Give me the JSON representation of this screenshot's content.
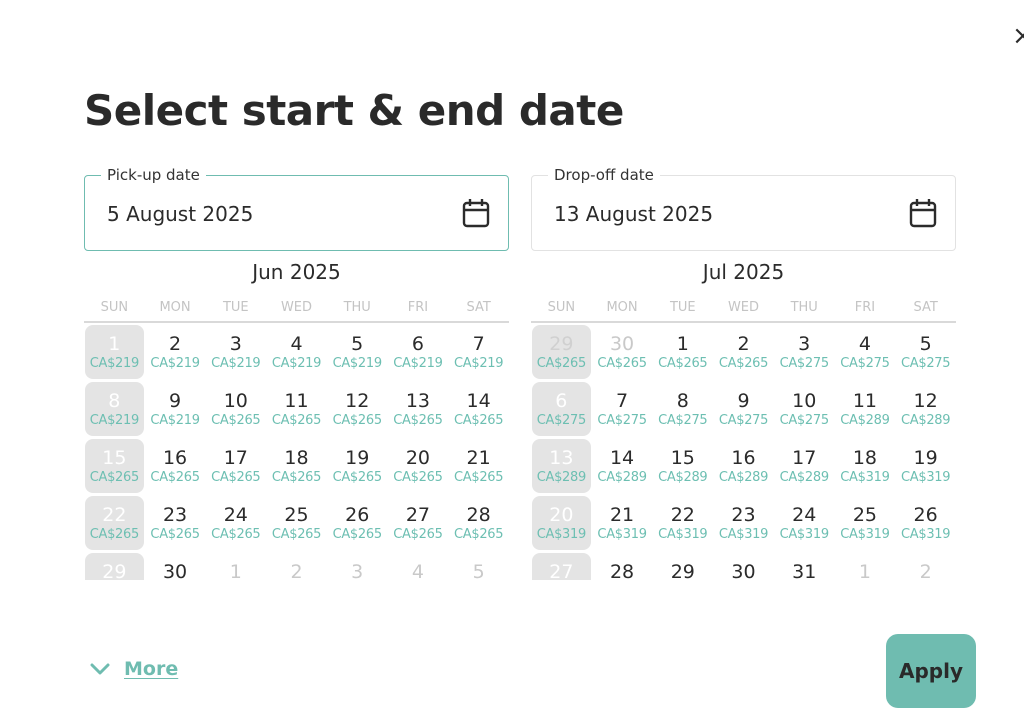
{
  "dialog": {
    "title": "Select start & end date",
    "close_icon": "close-icon"
  },
  "pickup": {
    "label": "Pick-up date",
    "value": "5 August 2025",
    "icon": "calendar-icon"
  },
  "dropoff": {
    "label": "Drop-off date",
    "value": "13 August 2025",
    "icon": "calendar-icon"
  },
  "weekdays": [
    "SUN",
    "MON",
    "TUE",
    "WED",
    "THU",
    "FRI",
    "SAT"
  ],
  "months": [
    {
      "title": "Jun 2025",
      "days": [
        {
          "n": "1",
          "p": "CA$219",
          "f": false
        },
        {
          "n": "2",
          "p": "CA$219",
          "f": false
        },
        {
          "n": "3",
          "p": "CA$219",
          "f": false
        },
        {
          "n": "4",
          "p": "CA$219",
          "f": false
        },
        {
          "n": "5",
          "p": "CA$219",
          "f": false
        },
        {
          "n": "6",
          "p": "CA$219",
          "f": false
        },
        {
          "n": "7",
          "p": "CA$219",
          "f": false
        },
        {
          "n": "8",
          "p": "CA$219",
          "f": false
        },
        {
          "n": "9",
          "p": "CA$219",
          "f": false
        },
        {
          "n": "10",
          "p": "CA$265",
          "f": false
        },
        {
          "n": "11",
          "p": "CA$265",
          "f": false
        },
        {
          "n": "12",
          "p": "CA$265",
          "f": false
        },
        {
          "n": "13",
          "p": "CA$265",
          "f": false
        },
        {
          "n": "14",
          "p": "CA$265",
          "f": false
        },
        {
          "n": "15",
          "p": "CA$265",
          "f": false
        },
        {
          "n": "16",
          "p": "CA$265",
          "f": false
        },
        {
          "n": "17",
          "p": "CA$265",
          "f": false
        },
        {
          "n": "18",
          "p": "CA$265",
          "f": false
        },
        {
          "n": "19",
          "p": "CA$265",
          "f": false
        },
        {
          "n": "20",
          "p": "CA$265",
          "f": false
        },
        {
          "n": "21",
          "p": "CA$265",
          "f": false
        },
        {
          "n": "22",
          "p": "CA$265",
          "f": false
        },
        {
          "n": "23",
          "p": "CA$265",
          "f": false
        },
        {
          "n": "24",
          "p": "CA$265",
          "f": false
        },
        {
          "n": "25",
          "p": "CA$265",
          "f": false
        },
        {
          "n": "26",
          "p": "CA$265",
          "f": false
        },
        {
          "n": "27",
          "p": "CA$265",
          "f": false
        },
        {
          "n": "28",
          "p": "CA$265",
          "f": false
        },
        {
          "n": "29",
          "p": "",
          "f": false
        },
        {
          "n": "30",
          "p": "",
          "f": false
        },
        {
          "n": "1",
          "p": "",
          "f": true
        },
        {
          "n": "2",
          "p": "",
          "f": true
        },
        {
          "n": "3",
          "p": "",
          "f": true
        },
        {
          "n": "4",
          "p": "",
          "f": true
        },
        {
          "n": "5",
          "p": "",
          "f": true
        }
      ]
    },
    {
      "title": "Jul 2025",
      "days": [
        {
          "n": "29",
          "p": "CA$265",
          "f": true
        },
        {
          "n": "30",
          "p": "CA$265",
          "f": true
        },
        {
          "n": "1",
          "p": "CA$265",
          "f": false
        },
        {
          "n": "2",
          "p": "CA$265",
          "f": false
        },
        {
          "n": "3",
          "p": "CA$275",
          "f": false
        },
        {
          "n": "4",
          "p": "CA$275",
          "f": false
        },
        {
          "n": "5",
          "p": "CA$275",
          "f": false
        },
        {
          "n": "6",
          "p": "CA$275",
          "f": false
        },
        {
          "n": "7",
          "p": "CA$275",
          "f": false
        },
        {
          "n": "8",
          "p": "CA$275",
          "f": false
        },
        {
          "n": "9",
          "p": "CA$275",
          "f": false
        },
        {
          "n": "10",
          "p": "CA$275",
          "f": false
        },
        {
          "n": "11",
          "p": "CA$289",
          "f": false
        },
        {
          "n": "12",
          "p": "CA$289",
          "f": false
        },
        {
          "n": "13",
          "p": "CA$289",
          "f": false
        },
        {
          "n": "14",
          "p": "CA$289",
          "f": false
        },
        {
          "n": "15",
          "p": "CA$289",
          "f": false
        },
        {
          "n": "16",
          "p": "CA$289",
          "f": false
        },
        {
          "n": "17",
          "p": "CA$289",
          "f": false
        },
        {
          "n": "18",
          "p": "CA$319",
          "f": false
        },
        {
          "n": "19",
          "p": "CA$319",
          "f": false
        },
        {
          "n": "20",
          "p": "CA$319",
          "f": false
        },
        {
          "n": "21",
          "p": "CA$319",
          "f": false
        },
        {
          "n": "22",
          "p": "CA$319",
          "f": false
        },
        {
          "n": "23",
          "p": "CA$319",
          "f": false
        },
        {
          "n": "24",
          "p": "CA$319",
          "f": false
        },
        {
          "n": "25",
          "p": "CA$319",
          "f": false
        },
        {
          "n": "26",
          "p": "CA$319",
          "f": false
        },
        {
          "n": "27",
          "p": "",
          "f": false
        },
        {
          "n": "28",
          "p": "",
          "f": false
        },
        {
          "n": "29",
          "p": "",
          "f": false
        },
        {
          "n": "30",
          "p": "",
          "f": false
        },
        {
          "n": "31",
          "p": "",
          "f": false
        },
        {
          "n": "1",
          "p": "",
          "f": true
        },
        {
          "n": "2",
          "p": "",
          "f": true
        }
      ]
    }
  ],
  "footer": {
    "more_label": "More",
    "more_icon": "chevron-down-icon",
    "apply_label": "Apply"
  },
  "colors": {
    "accent": "#6fbcb0",
    "price": "#6dbfb2",
    "sunday_bg": "#e4e4e4",
    "text": "#2b2b2b"
  }
}
